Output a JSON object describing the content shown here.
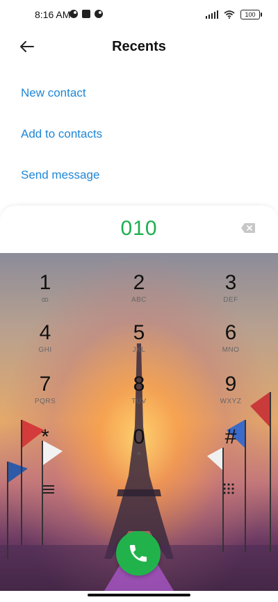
{
  "status": {
    "time": "8:16 AM",
    "battery": "100"
  },
  "header": {
    "title": "Recents"
  },
  "actions": [
    "New contact",
    "Add to contacts",
    "Send message"
  ],
  "dialer": {
    "number": "010"
  },
  "keys": [
    {
      "digit": "1",
      "letters": "ꝏ"
    },
    {
      "digit": "2",
      "letters": "ABC"
    },
    {
      "digit": "3",
      "letters": "DEF"
    },
    {
      "digit": "4",
      "letters": "GHI"
    },
    {
      "digit": "5",
      "letters": "JKL"
    },
    {
      "digit": "6",
      "letters": "MNO"
    },
    {
      "digit": "7",
      "letters": "PQRS"
    },
    {
      "digit": "8",
      "letters": "TUV"
    },
    {
      "digit": "9",
      "letters": "WXYZ"
    },
    {
      "digit": "*",
      "letters": ""
    },
    {
      "digit": "0",
      "letters": "+"
    },
    {
      "digit": "#",
      "letters": ""
    }
  ],
  "colors": {
    "accent_blue": "#1f86d6",
    "number_green": "#1bb04f",
    "call_green": "#22b24c"
  },
  "icons": {
    "back": "back-arrow-icon",
    "backspace": "backspace-icon",
    "call": "phone-icon",
    "menu": "menu-icon",
    "grid": "grid-icon"
  }
}
